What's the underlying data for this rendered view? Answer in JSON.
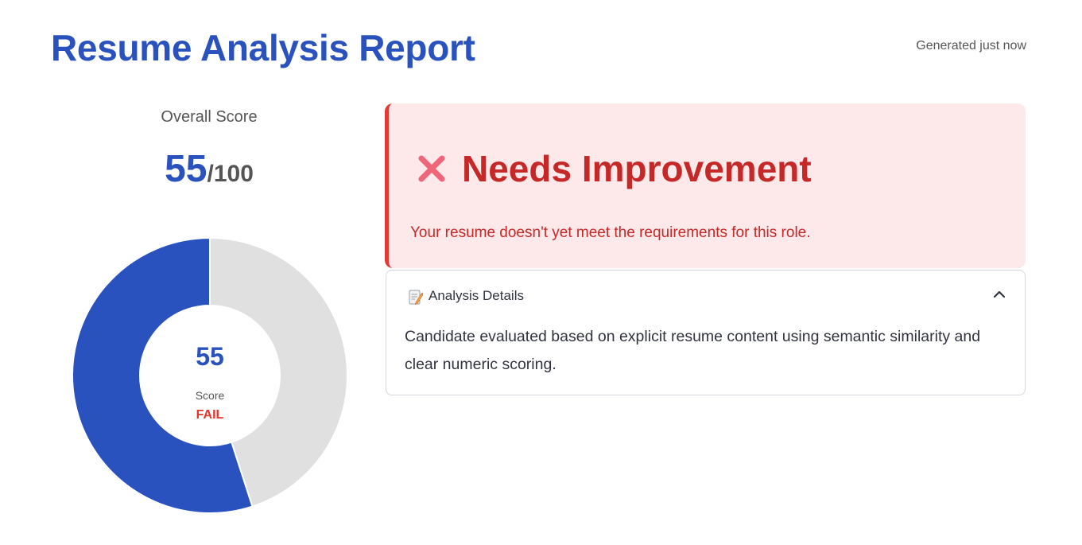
{
  "header": {
    "title": "Resume Analysis Report",
    "generated": "Generated just now"
  },
  "score": {
    "caption": "Overall Score",
    "value": "55",
    "max": "/100",
    "donut_value": "55",
    "donut_label": "Score",
    "donut_status": "FAIL"
  },
  "chart_data": {
    "type": "pie",
    "categories": [
      "Score",
      "Remaining"
    ],
    "values": [
      55,
      45
    ],
    "colors": [
      "#2a52be",
      "#e0e0e0"
    ]
  },
  "verdict": {
    "icon": "x-icon",
    "title": "Needs Improvement",
    "message": "Your resume doesn't yet meet the requirements for this role."
  },
  "details": {
    "icon": "memo-icon",
    "title": "Analysis Details",
    "body": "Candidate evaluated based on explicit resume content using semantic similarity and clear numeric scoring."
  },
  "colors": {
    "accent": "#2a52be",
    "fail": "#e0362c",
    "verdict_bg": "#fde8ea",
    "verdict_border": "#e53935"
  }
}
